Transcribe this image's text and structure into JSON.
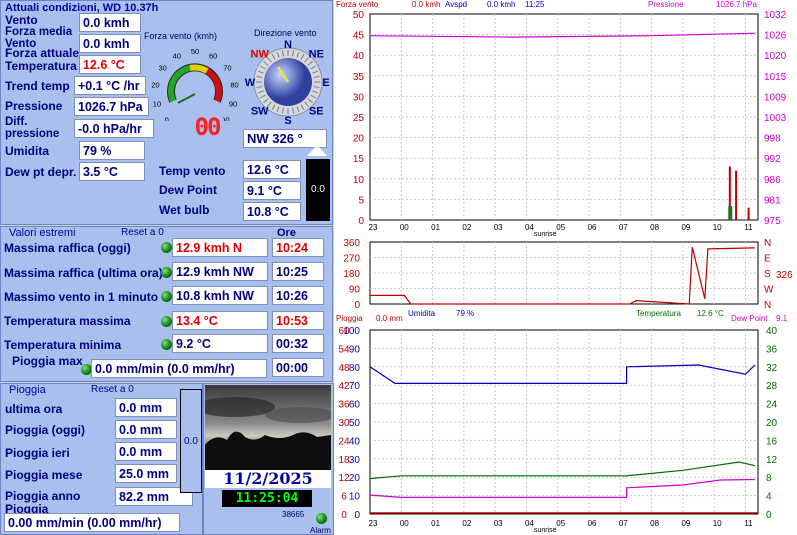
{
  "current": {
    "title": "Attuali condizioni, WD 10.37h",
    "rows": [
      {
        "label": "Vento",
        "value": "0.0 kmh"
      },
      {
        "label": "Forza media Vento",
        "value": "0.0 kmh"
      },
      {
        "label": "Forza attuale",
        "value": ""
      },
      {
        "label": "Temperatura",
        "value": "12.6 °C"
      },
      {
        "label": "Trend temp",
        "value": "+0.1 °C /hr"
      },
      {
        "label": "Pressione",
        "value": "1026.7 hPa"
      },
      {
        "label": "Diff. pressione",
        "value": "-0.0 hPa/hr"
      },
      {
        "label": "Umidita",
        "value": "79 %"
      },
      {
        "label": "Dew pt depr.",
        "value": "3.5 °C"
      }
    ],
    "gauge_title": "Forza vento (kmh)",
    "gauge_ticks": [
      "0",
      "10",
      "20",
      "30",
      "40",
      "50",
      "60",
      "70",
      "80",
      "90",
      "100"
    ],
    "gauge_digital": "00",
    "compass_title": "Direzione vento",
    "compass_points": [
      "N",
      "NE",
      "E",
      "SE",
      "S",
      "SW",
      "W",
      "NW"
    ],
    "direction_value": "NW  326 °",
    "direction_degrees": 326,
    "temp_vento_label": "Temp vento",
    "temp_vento": "12.6 °C",
    "dew_point_label": "Dew Point",
    "dew_point": "9.1 °C",
    "wet_bulb_label": "Wet bulb",
    "wet_bulb": "10.8 °C",
    "bar_value": "0.0"
  },
  "extremes": {
    "title": "Valori estremi",
    "reset": "Reset a 0",
    "ore_title": "Ore",
    "rows": [
      {
        "label": "Massima raffica (oggi)",
        "value": "12.9 kmh   N",
        "time": "10:24",
        "red": true
      },
      {
        "label": "Massima raffica (ultima ora)",
        "value": "12.9 kmh  NW",
        "time": "10:25",
        "red": false
      },
      {
        "label": "Massimo vento in 1 minuto",
        "value": "10.8 kmh  NW",
        "time": "10:26",
        "red": false
      },
      {
        "label": "Temperatura massima",
        "value": "13.4 °C",
        "time": "10:53",
        "red": true
      },
      {
        "label": "Temperatura minima",
        "value": "9.2 °C",
        "time": "00:32",
        "red": false
      },
      {
        "label": "Pioggia max",
        "value": "0.0 mm/min (0.0 mm/hr)",
        "time": "00:00",
        "red": false
      }
    ]
  },
  "rain": {
    "title": "Pioggia",
    "reset": "Reset a 0",
    "rows": [
      {
        "label": "ultima ora",
        "value": "0.0 mm"
      },
      {
        "label": "Pioggia (oggi)",
        "value": "0.0 mm"
      },
      {
        "label": "Pioggia ieri",
        "value": "0.0 mm"
      },
      {
        "label": "Pioggia mese",
        "value": "25.0 mm"
      },
      {
        "label": "Pioggia anno",
        "value": "82.2 mm"
      }
    ],
    "rate_label": "Pioggia",
    "rate_value": "0.00 mm/min (0.00 mm/hr)",
    "bar_value": "0.0"
  },
  "clock": {
    "date": "11/2/2025",
    "time": "11:25:04",
    "counter": "38665",
    "alarm_label": "Alarm"
  },
  "colors": {
    "panel": "#a9c0ef",
    "wind": "#c00000",
    "pressure": "#d000d0",
    "temperature": "#007000",
    "humidity": "#0000c0",
    "dewpoint": "#d000d0"
  },
  "graph_top": {
    "header": {
      "wind_label": "Forza vento",
      "wind_value": "0.0 kmh",
      "avspd_label": "Avspd",
      "avspd_value": "0.0 kmh",
      "time": "11:25",
      "pressure_label": "Pressione",
      "pressure_value": "1026.7 hPa"
    },
    "left_ticks": [
      "0",
      "5",
      "10",
      "15",
      "20",
      "25",
      "30",
      "35",
      "40",
      "45",
      "50"
    ],
    "right_ticks": [
      "975",
      "981",
      "986",
      "992",
      "998",
      "1003",
      "1009",
      "1015",
      "1020",
      "1026",
      "1032"
    ],
    "x_labels": [
      "23",
      "00",
      "01",
      "02",
      "03",
      "04",
      "05",
      "06",
      "07",
      "08",
      "09",
      "10",
      "11"
    ],
    "sunrise": "sunrise"
  },
  "graph_mid": {
    "left_ticks": [
      "0",
      "90",
      "180",
      "270",
      "360"
    ],
    "right_ticks": [
      "N",
      "W",
      "S",
      "E",
      "N"
    ],
    "direction_value": "326",
    "footer": {
      "humidity_label": "Umidita",
      "humidity_value": "79 %",
      "temp_label": "Temperatura",
      "temp_value": "12.6 °C"
    }
  },
  "graph_bottom": {
    "header": {
      "rain_label": "Pioggia",
      "rain_value": "0.0 mm",
      "dew_label": "Dew Point",
      "dew_value": "9.1"
    },
    "left_red_ticks": [
      "0",
      "6",
      "12",
      "18",
      "24",
      "30",
      "36",
      "42",
      "48",
      "54",
      "60"
    ],
    "left_blue_ticks": [
      "0",
      "10",
      "20",
      "30",
      "40",
      "50",
      "60",
      "70",
      "80",
      "90",
      "100"
    ],
    "right_ticks": [
      "0",
      "4",
      "8",
      "12",
      "16",
      "20",
      "24",
      "28",
      "32",
      "36",
      "40"
    ],
    "x_labels": [
      "23",
      "00",
      "01",
      "02",
      "03",
      "04",
      "05",
      "06",
      "07",
      "08",
      "09",
      "10",
      "11"
    ],
    "sunrise": "sunrise"
  },
  "chart_data": [
    {
      "type": "line",
      "title": "Forza vento / Pressione",
      "x_hours": [
        "23",
        "00",
        "01",
        "02",
        "03",
        "04",
        "05",
        "06",
        "07",
        "08",
        "09",
        "10",
        "11"
      ],
      "ylim_left": [
        0,
        50
      ],
      "ylim_right": [
        975,
        1032
      ],
      "series": [
        {
          "name": "Pressione",
          "axis": "right",
          "points": [
            [
              0,
              1026.0
            ],
            [
              4.5,
              1025.6
            ],
            [
              9,
              1026.0
            ],
            [
              12.3,
              1026.7
            ]
          ]
        },
        {
          "name": "Forza vento",
          "axis": "left",
          "points": [
            [
              0,
              0
            ],
            [
              11.4,
              0
            ],
            [
              11.5,
              13
            ],
            [
              11.6,
              0
            ],
            [
              11.7,
              12
            ],
            [
              11.8,
              0
            ],
            [
              12.1,
              3
            ],
            [
              12.3,
              0
            ]
          ]
        }
      ]
    },
    {
      "type": "line",
      "title": "Direzione vento",
      "ylim": [
        0,
        360
      ],
      "series": [
        {
          "name": "Direzione",
          "points": [
            [
              0,
              50
            ],
            [
              1.1,
              50
            ],
            [
              1.3,
              0
            ],
            [
              8.3,
              0
            ],
            [
              8.5,
              20
            ],
            [
              10.2,
              0
            ],
            [
              10.3,
              330
            ],
            [
              10.7,
              30
            ],
            [
              10.8,
              320
            ],
            [
              12.3,
              326
            ]
          ]
        }
      ]
    },
    {
      "type": "line",
      "title": "Umidita / Temperatura / Dew Point",
      "ylim_humidity": [
        0,
        100
      ],
      "ylim_temperature": [
        0,
        40
      ],
      "series": [
        {
          "name": "Umidita",
          "points": [
            [
              0,
              80
            ],
            [
              0.8,
              71
            ],
            [
              8.2,
              71
            ],
            [
              8.2,
              80
            ],
            [
              10.5,
              81
            ],
            [
              12.0,
              76
            ],
            [
              12.3,
              81
            ]
          ]
        },
        {
          "name": "Temperatura",
          "points": [
            [
              0,
              7.7
            ],
            [
              1.0,
              8.3
            ],
            [
              8.2,
              8.3
            ],
            [
              10,
              9.5
            ],
            [
              11.8,
              11.3
            ],
            [
              12.3,
              10.5
            ]
          ]
        },
        {
          "name": "Dew Point",
          "points": [
            [
              0,
              4.1
            ],
            [
              1.0,
              3.6
            ],
            [
              8.2,
              3.6
            ],
            [
              8.2,
              5.7
            ],
            [
              10,
              6.3
            ],
            [
              11.2,
              7.4
            ],
            [
              12.3,
              7.5
            ]
          ]
        }
      ]
    }
  ]
}
